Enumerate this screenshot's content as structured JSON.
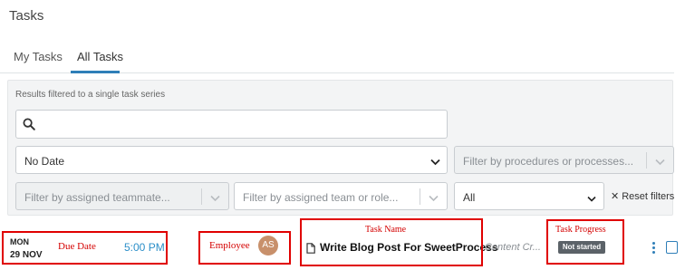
{
  "page": {
    "title": "Tasks"
  },
  "tabs": [
    {
      "label": "My Tasks",
      "active": false
    },
    {
      "label": "All Tasks",
      "active": true
    }
  ],
  "filters": {
    "note": "Results filtered to a single task series",
    "search": {
      "value": "",
      "placeholder": ""
    },
    "date": {
      "value": "No Date"
    },
    "procedures": {
      "placeholder": "Filter by procedures or processes..."
    },
    "teammate": {
      "placeholder": "Filter by assigned teammate..."
    },
    "team": {
      "placeholder": "Filter by assigned team or role..."
    },
    "scope": {
      "value": "All"
    },
    "reset_label": "Reset filters"
  },
  "task": {
    "day": "MON",
    "date": "29 NOV",
    "time": "5:00 PM",
    "employee_initials": "AS",
    "name": "Write Blog Post For SweetProcess",
    "series": "Content Cr...",
    "status": "Not started"
  },
  "annotations": {
    "due_date": "Due Date",
    "employee": "Employee",
    "task_name": "Task Name",
    "task_progress": "Task Progress"
  },
  "colors": {
    "accent": "#2f7fb8",
    "time": "#2c8fc9",
    "annotation": "#e00000",
    "badge": "#5b6268"
  },
  "icons": [
    "search-icon",
    "chevron-down-icon",
    "close-icon",
    "document-icon",
    "kebab-menu-icon",
    "checkbox-icon"
  ]
}
